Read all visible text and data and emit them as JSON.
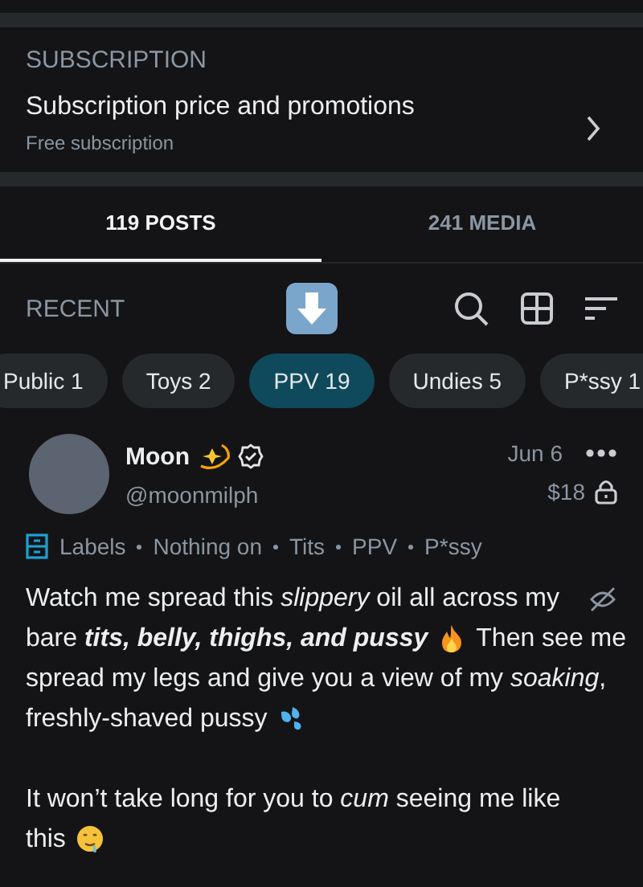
{
  "subscription": {
    "heading": "SUBSCRIPTION",
    "title": "Subscription price and promotions",
    "subtitle": "Free subscription"
  },
  "tabs": [
    {
      "label": "119 POSTS",
      "selected": true
    },
    {
      "label": "241 MEDIA",
      "selected": false
    }
  ],
  "feed_header": {
    "title": "RECENT"
  },
  "filters": [
    {
      "label": "Public 1",
      "selected": false
    },
    {
      "label": "Toys 2",
      "selected": false
    },
    {
      "label": "PPV 19",
      "selected": true
    },
    {
      "label": "Undies 5",
      "selected": false
    },
    {
      "label": "P*ssy 1",
      "selected": false
    }
  ],
  "post": {
    "name": "Moon",
    "handle": "@moonmilph",
    "date": "Jun 6",
    "price": "$18",
    "verified": true,
    "locked": true,
    "labels_title": "Labels",
    "labels": [
      "Nothing on",
      "Tits",
      "PPV",
      "P*ssy"
    ],
    "paragraphs": [
      {
        "lines": [
          {
            "kind": "plain",
            "text": "Watch me spread this *slippery* oil all across my"
          },
          {
            "kind": "fire",
            "text": "bare **tits, belly, thighs, and pussy**",
            "after": "Then see me"
          },
          {
            "kind": "plain",
            "text": "spread my legs and give you a view of my *soaking*,"
          },
          {
            "kind": "droplets",
            "text": "freshly-shaved pussy"
          }
        ]
      },
      {
        "lines": [
          {
            "kind": "plain",
            "text": "It won’t take long for you to *cum* seeing me like"
          },
          {
            "kind": "drool",
            "text": "this"
          }
        ]
      }
    ]
  }
}
